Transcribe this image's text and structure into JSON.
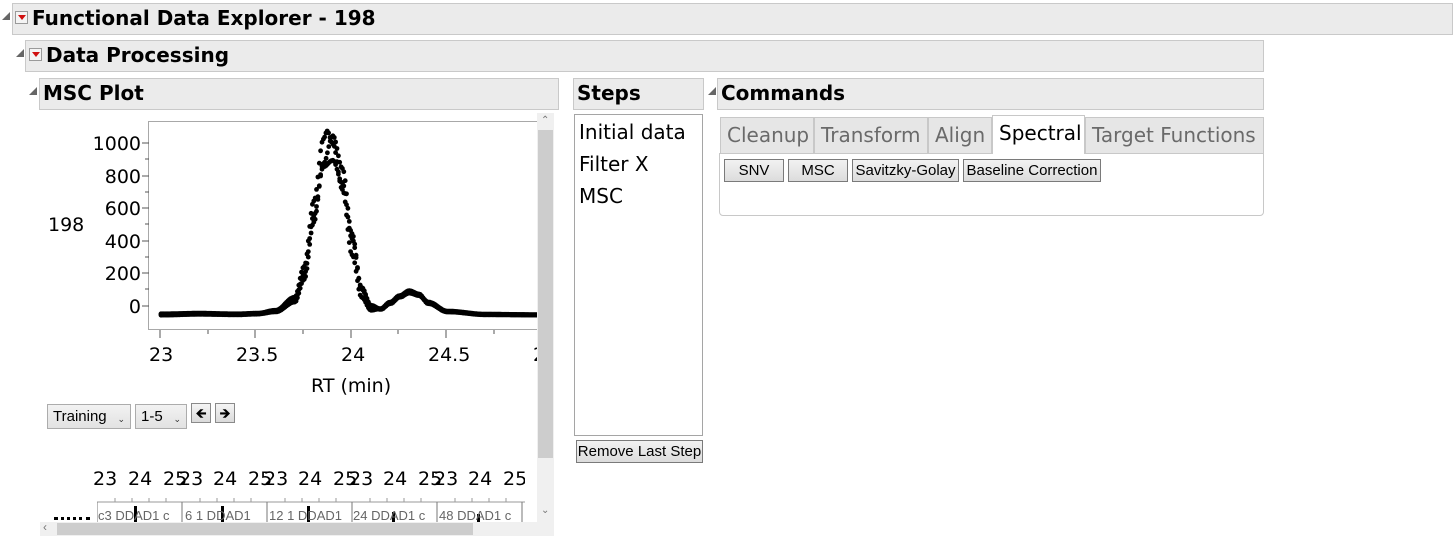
{
  "window": {
    "title": "Functional Data Explorer - 198"
  },
  "data_processing": {
    "title": "Data Processing"
  },
  "msc_plot": {
    "title": "MSC Plot",
    "row_label": "198",
    "y_ticks": [
      "1000",
      "800",
      "600",
      "400",
      "200",
      "0"
    ],
    "x_ticks": [
      "23",
      "23.5",
      "24",
      "24.5",
      "2"
    ],
    "x_axis_label": "RT (min)",
    "set_select": "Training",
    "range_select": "1-5",
    "prev_icon": "arrow-left",
    "next_icon": "arrow-right",
    "mini_plots": {
      "ticks": [
        "23",
        "24",
        "25",
        "23",
        "24",
        "25",
        "23",
        "24",
        "25",
        "23",
        "24",
        "25",
        "23",
        "24",
        "25"
      ],
      "labels": [
        "c3 DDAD1 c",
        "6 1 DDAD1",
        "12 1 DDAD1",
        "24 DDAD1 c",
        "48 DDAD1 c"
      ]
    }
  },
  "steps": {
    "title": "Steps",
    "items": [
      "Initial data",
      "Filter X",
      "MSC"
    ],
    "remove_button": "Remove Last Step"
  },
  "commands": {
    "title": "Commands",
    "tabs": [
      "Cleanup",
      "Transform",
      "Align",
      "Spectral",
      "Target Functions"
    ],
    "active_tab": "Spectral",
    "buttons": [
      "SNV",
      "MSC",
      "Savitzky-Golay",
      "Baseline Correction"
    ]
  },
  "chart_data": {
    "type": "scatter",
    "xlabel": "RT (min)",
    "ylabel": "",
    "xlim": [
      22.97,
      25.0
    ],
    "ylim": [
      -60,
      1120
    ],
    "series": [
      {
        "x": [
          23.0,
          23.2,
          23.4,
          23.5,
          23.6,
          23.7,
          23.75,
          23.8,
          23.85,
          23.87,
          23.9,
          23.95,
          24.0,
          24.05,
          24.1,
          24.15,
          24.2,
          24.25,
          24.3,
          24.35,
          24.4,
          24.5,
          24.7,
          25.0
        ],
        "y": [
          -45,
          -40,
          -45,
          -40,
          -20,
          60,
          250,
          650,
          1030,
          1080,
          1000,
          720,
          320,
          60,
          -20,
          -10,
          30,
          70,
          100,
          80,
          20,
          -30,
          -45,
          -48
        ]
      },
      {
        "x": [
          23.0,
          23.2,
          23.4,
          23.5,
          23.6,
          23.7,
          23.75,
          23.8,
          23.85,
          23.9,
          23.95,
          24.0,
          24.05,
          24.1,
          24.15,
          24.2,
          24.25,
          24.3,
          24.35,
          24.4,
          24.5,
          24.7,
          25.0
        ],
        "y": [
          -50,
          -45,
          -48,
          -44,
          -30,
          30,
          170,
          520,
          880,
          1050,
          850,
          450,
          110,
          0,
          -15,
          20,
          60,
          85,
          70,
          25,
          -30,
          -48,
          -50
        ]
      },
      {
        "x": [
          23.0,
          23.2,
          23.4,
          23.5,
          23.6,
          23.7,
          23.75,
          23.8,
          23.85,
          23.9,
          23.95,
          24.0,
          24.05,
          24.1,
          24.15,
          24.2,
          24.25,
          24.3,
          24.35,
          24.4,
          24.5,
          24.7,
          25.0
        ],
        "y": [
          -42,
          -38,
          -42,
          -38,
          -25,
          45,
          200,
          560,
          860,
          900,
          760,
          420,
          120,
          10,
          -12,
          25,
          65,
          90,
          75,
          30,
          -25,
          -44,
          -47
        ]
      }
    ]
  }
}
